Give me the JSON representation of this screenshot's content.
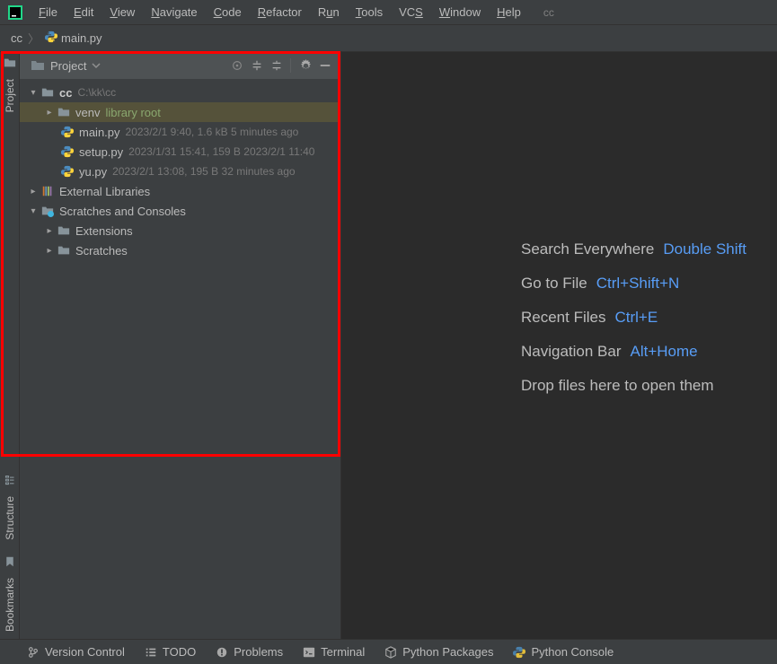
{
  "menu": {
    "file": "File",
    "edit": "Edit",
    "view": "View",
    "navigate": "Navigate",
    "code": "Code",
    "refactor": "Refactor",
    "run": "Run",
    "tools": "Tools",
    "vcs": "VCS",
    "window": "Window",
    "help": "Help",
    "project_name": "cc"
  },
  "breadcrumb": {
    "root": "cc",
    "file": "main.py"
  },
  "gutter": {
    "project": "Project",
    "structure": "Structure",
    "bookmarks": "Bookmarks"
  },
  "toolwin": {
    "title": "Project"
  },
  "tree": {
    "root": {
      "name": "cc",
      "path": "C:\\kk\\cc"
    },
    "venv": {
      "name": "venv",
      "tag": "library root"
    },
    "files": [
      {
        "name": "main.py",
        "meta": "2023/2/1 9:40, 1.6 kB 5 minutes ago"
      },
      {
        "name": "setup.py",
        "meta": "2023/1/31 15:41, 159 B 2023/2/1 11:40"
      },
      {
        "name": "yu.py",
        "meta": "2023/2/1 13:08, 195 B 32 minutes ago"
      }
    ],
    "ext_lib": "External Libraries",
    "scratches": "Scratches and Consoles",
    "scratches_children": [
      "Extensions",
      "Scratches"
    ]
  },
  "tips": [
    {
      "label": "Search Everywhere",
      "key": "Double Shift"
    },
    {
      "label": "Go to File",
      "key": "Ctrl+Shift+N"
    },
    {
      "label": "Recent Files",
      "key": "Ctrl+E"
    },
    {
      "label": "Navigation Bar",
      "key": "Alt+Home"
    },
    {
      "label": "Drop files here to open them",
      "key": ""
    }
  ],
  "bottom": {
    "vcs": "Version Control",
    "todo": "TODO",
    "problems": "Problems",
    "terminal": "Terminal",
    "pypkg": "Python Packages",
    "pycon": "Python Console"
  }
}
